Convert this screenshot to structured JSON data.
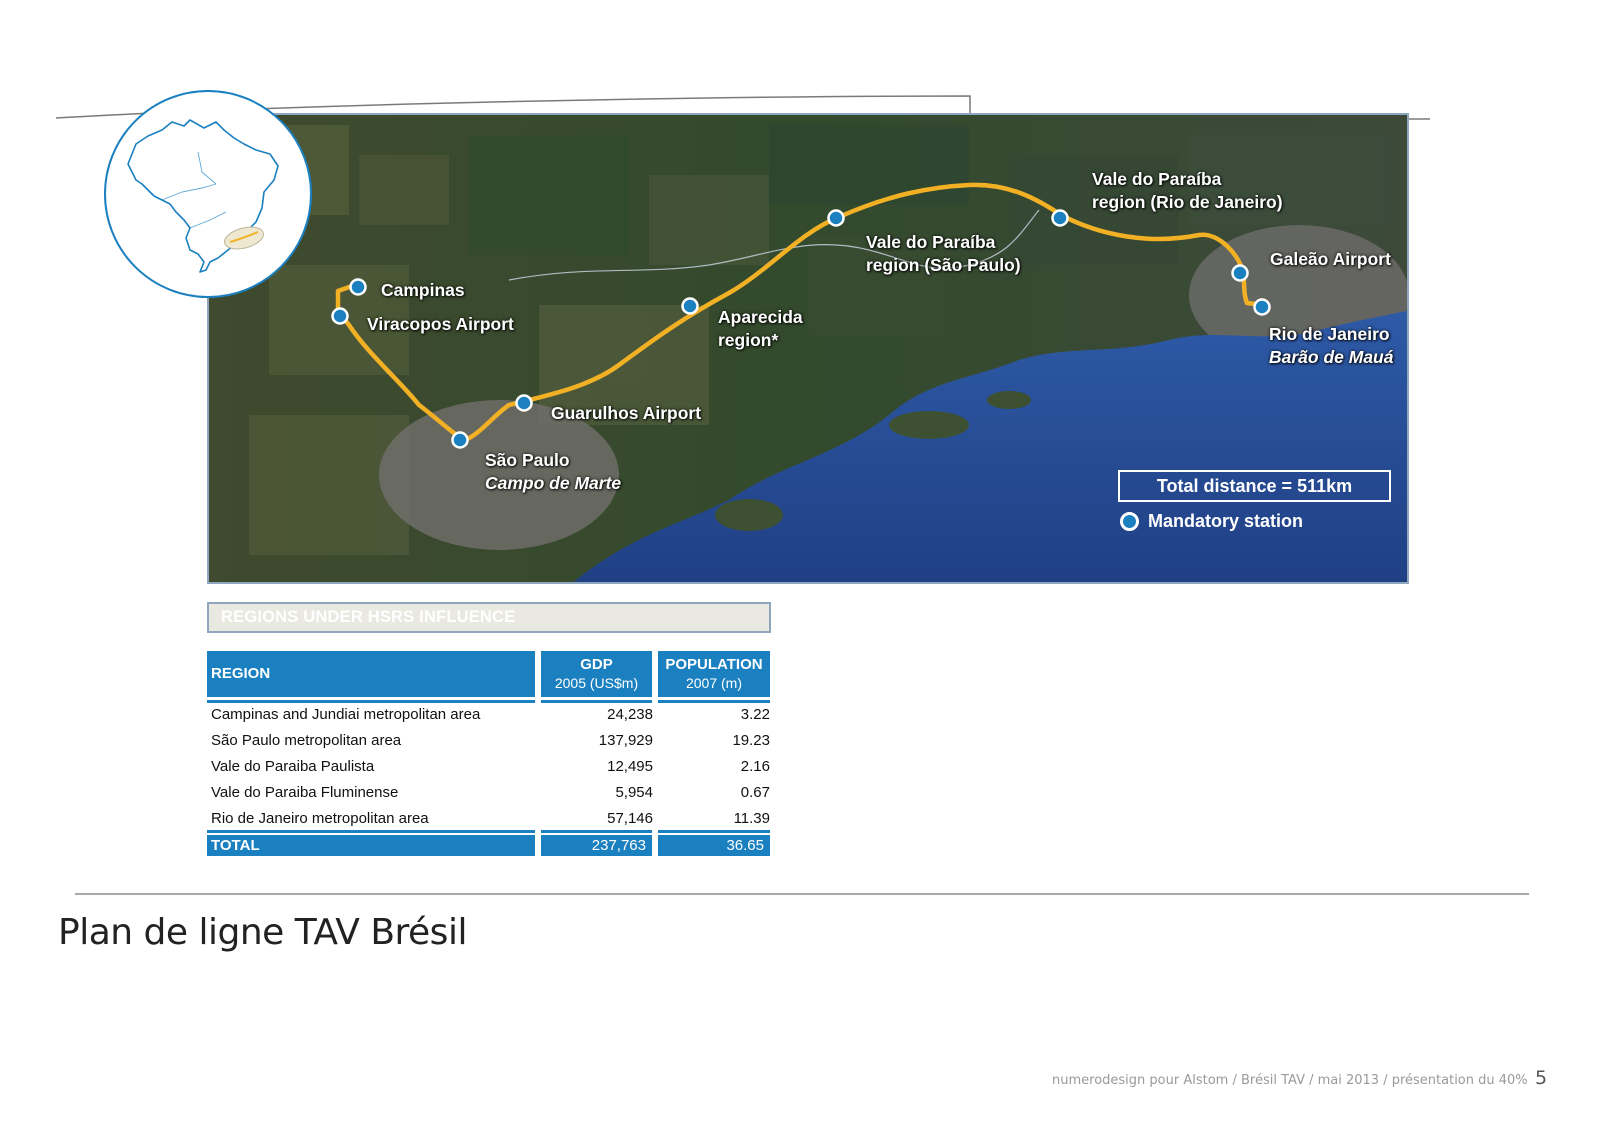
{
  "map": {
    "stations": [
      {
        "id": "campinas",
        "label": "Campinas"
      },
      {
        "id": "viracopos",
        "label": "Viracopos Airport"
      },
      {
        "id": "guarulhos",
        "label": "Guarulhos Airport"
      },
      {
        "id": "sao-paulo",
        "label": "São Paulo",
        "sub": "Campo de Marte"
      },
      {
        "id": "aparecida",
        "label": "Aparecida",
        "label2": "region*"
      },
      {
        "id": "vale-sp",
        "label": "Vale do Paraíba",
        "label2": "region (São Paulo)"
      },
      {
        "id": "vale-rj",
        "label": "Vale do Paraíba",
        "label2": "region (Rio de Janeiro)"
      },
      {
        "id": "galeao",
        "label": "Galeão Airport"
      },
      {
        "id": "rio",
        "label": "Rio de Janeiro",
        "sub": "Barão de Mauá"
      }
    ],
    "total_distance": "Total distance = 511km",
    "legend_label": "Mandatory station",
    "colors": {
      "route": "#f2b125",
      "station": "#1b80c0",
      "sea": "#2a4f97"
    }
  },
  "table": {
    "title": "REGIONS UNDER HSRS  INFLUENCE",
    "headers": {
      "region": "REGION",
      "gdp": "GDP",
      "gdp_sub": "2005 (US$m)",
      "population": "POPULATION",
      "population_sub": "2007 (m)"
    },
    "rows": [
      {
        "region": "Campinas and Jundiai metropolitan area",
        "gdp": "24,238",
        "population": "3.22"
      },
      {
        "region": "São Paulo metropolitan area",
        "gdp": "137,929",
        "population": "19.23"
      },
      {
        "region": "Vale do Paraiba Paulista",
        "gdp": "12,495",
        "population": "2.16"
      },
      {
        "region": "Vale do Paraiba Fluminense",
        "gdp": "5,954",
        "population": "0.67"
      },
      {
        "region": "Rio de Janeiro metropolitan area",
        "gdp": "57,146",
        "population": "11.39"
      }
    ],
    "total": {
      "region": "TOTAL",
      "gdp": "237,763",
      "population": "36.65"
    },
    "colors": {
      "header": "#1b80c0"
    }
  },
  "page": {
    "title": "Plan de ligne TAV Brésil",
    "footer": "numerodesign pour Alstom / Brésil TAV / mai 2013 / présentation du 40%",
    "number": "5"
  }
}
